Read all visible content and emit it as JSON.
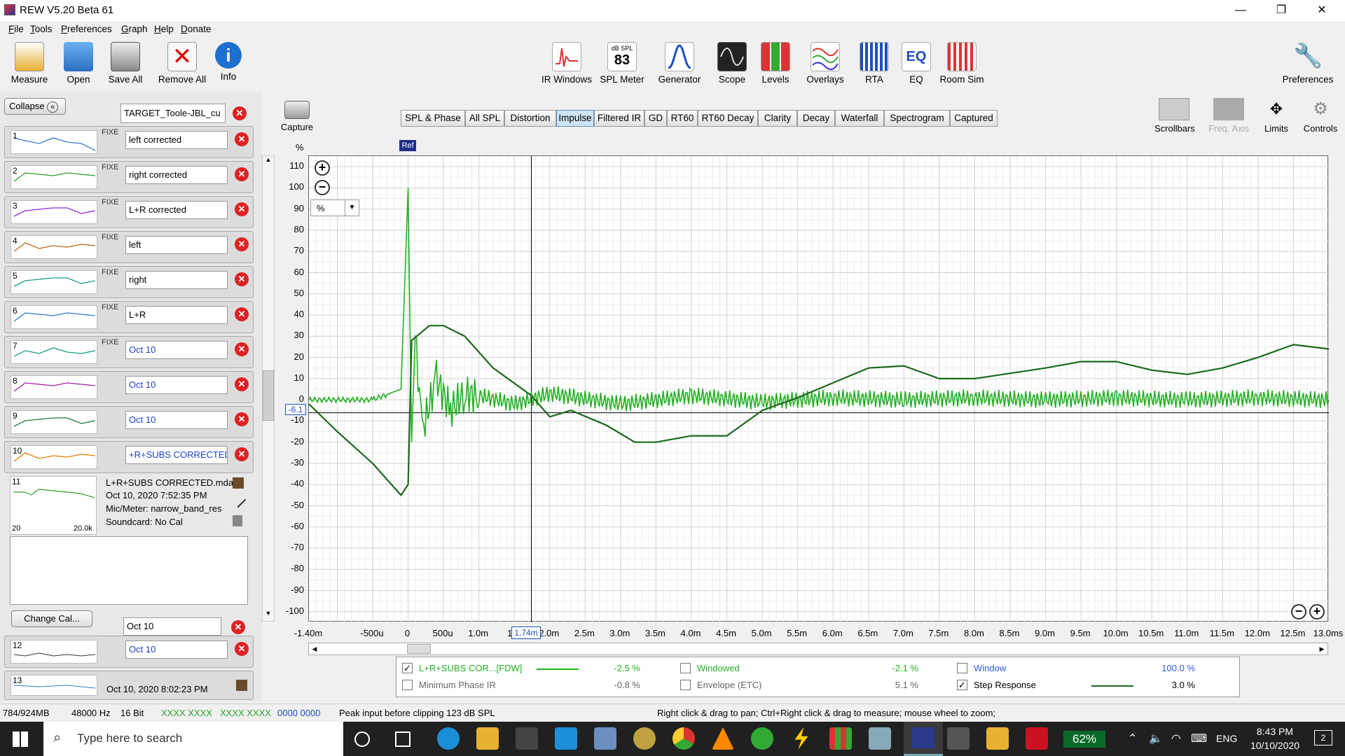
{
  "window": {
    "title": "REW V5.20 Beta 61",
    "minimize": "—",
    "maximize": "❐",
    "close": "✕"
  },
  "menu": [
    "File",
    "Tools",
    "Preferences",
    "Graph",
    "Help",
    "Donate"
  ],
  "toolbar": {
    "left": [
      "Measure",
      "Open",
      "Save All",
      "Remove All",
      "Info"
    ],
    "center": [
      "IR Windows",
      "SPL Meter",
      "Generator",
      "Scope",
      "Levels",
      "Overlays",
      "RTA",
      "EQ",
      "Room Sim"
    ],
    "spl_meter": {
      "unit": "dB SPL",
      "value": "83"
    },
    "eq_icon_text": "EQ",
    "right": "Preferences"
  },
  "capture": {
    "label": "Capture",
    "unit": "%"
  },
  "right_tools": [
    "Scrollbars",
    "Freq. Axis",
    "Limits",
    "Controls"
  ],
  "left_panel": {
    "collapse": "Collapse",
    "target": "TARGET_Toole-JBL_cu",
    "fixed_label": "FIXE",
    "measurements": [
      {
        "num": "1",
        "name": "left corrected",
        "color": "#3a7bd5",
        "fixed": true
      },
      {
        "num": "2",
        "name": "right corrected",
        "color": "#2aa02a",
        "fixed": true
      },
      {
        "num": "3",
        "name": "L+R corrected",
        "color": "#8a2be2",
        "fixed": true
      },
      {
        "num": "4",
        "name": "left",
        "color": "#b8651b",
        "fixed": true
      },
      {
        "num": "5",
        "name": "right",
        "color": "#1a9a8a",
        "fixed": true
      },
      {
        "num": "6",
        "name": "L+R",
        "color": "#2a7bd5",
        "fixed": true
      },
      {
        "num": "7",
        "name": "Oct 10",
        "color": "#1a9a8a",
        "fixed": true
      },
      {
        "num": "8",
        "name": "Oct 10",
        "color": "#a020a0",
        "fixed": false
      },
      {
        "num": "9",
        "name": "Oct 10",
        "color": "#1a7a3a",
        "fixed": false
      },
      {
        "num": "10",
        "name": "+R+SUBS CORRECTED",
        "color": "#e07b00",
        "fixed": false
      }
    ],
    "selected": {
      "num": "11",
      "file": "L+R+SUBS CORRECTED.mda",
      "date": "Oct 10, 2020 7:52:35 PM",
      "mic": "Mic/Meter: narrow_band_res",
      "soundcard": "Soundcard: No Cal",
      "xmin": "20",
      "xmax": "20.0k"
    },
    "change_cal": "Change Cal...",
    "m11_name": "Oct 10",
    "m12": {
      "num": "12",
      "name": "Oct 10"
    },
    "m13": {
      "num": "13",
      "date": "Oct 10, 2020 8:02:23 PM"
    }
  },
  "graph_tabs": [
    "SPL & Phase",
    "All SPL",
    "Distortion",
    "Impulse",
    "Filtered IR",
    "GD",
    "RT60",
    "RT60 Decay",
    "Clarity",
    "Decay",
    "Waterfall",
    "Spectrogram",
    "Captured"
  ],
  "active_tab": "Impulse",
  "graph": {
    "y_unit": "%",
    "unit_select": "%",
    "ref_marker": "Ref",
    "cursor_y": "-6.1",
    "cursor_x": "1.74m"
  },
  "chart_data": {
    "type": "line",
    "title": "",
    "xlabel": "",
    "ylabel": "%",
    "xlim": [
      -1.4,
      13.0
    ],
    "ylim": [
      -105,
      115
    ],
    "y_ticks": [
      "110",
      "100",
      "90",
      "80",
      "70",
      "60",
      "50",
      "40",
      "30",
      "20",
      "10",
      "0",
      "-10",
      "-20",
      "-30",
      "-40",
      "-50",
      "-60",
      "-70",
      "-80",
      "-90",
      "-100"
    ],
    "x_ticks": [
      "-1.40m",
      "-500u",
      "0",
      "500u",
      "1.0m",
      "1.5",
      "2.0m",
      "2.5m",
      "3.0m",
      "3.5m",
      "4.0m",
      "4.5m",
      "5.0m",
      "5.5m",
      "6.0m",
      "6.5m",
      "7.0m",
      "7.5m",
      "8.0m",
      "8.5m",
      "9.0m",
      "9.5m",
      "10.0m",
      "10.5m",
      "11.0m",
      "11.5m",
      "12.0m",
      "12.5m",
      "13.0ms"
    ],
    "series": [
      {
        "name": "L+R+SUBS COR...[FDW]",
        "color": "#22b022",
        "x": [
          -1.4,
          -1.0,
          -0.5,
          -0.1,
          0.0,
          0.05,
          0.1,
          0.2,
          0.4,
          0.6,
          0.8,
          1.0,
          1.5,
          2.0,
          3.0,
          4.0,
          5.0,
          6.0,
          7.0,
          8.0,
          9.0,
          10.0,
          11.0,
          12.0,
          13.0
        ],
        "y": [
          0,
          0,
          0,
          5,
          100,
          -20,
          30,
          -15,
          10,
          -5,
          3,
          2,
          -2,
          3,
          -2,
          2,
          -1,
          1,
          0,
          1,
          0,
          1,
          0,
          1,
          0
        ]
      },
      {
        "name": "Step Response",
        "color": "#1a6a1a",
        "x": [
          -1.4,
          -1.0,
          -0.5,
          -0.1,
          0.0,
          0.05,
          0.3,
          0.5,
          0.8,
          1.2,
          1.74,
          2.0,
          2.3,
          2.8,
          3.2,
          3.5,
          4.0,
          4.5,
          5.0,
          5.5,
          6.0,
          6.5,
          7.0,
          7.5,
          8.0,
          9.0,
          9.5,
          10.0,
          10.5,
          11.0,
          11.5,
          12.0,
          12.5,
          13.0
        ],
        "y": [
          -2,
          -15,
          -30,
          -45,
          -40,
          28,
          35,
          35,
          30,
          15,
          2,
          -8,
          -5,
          -12,
          -20,
          -20,
          -17,
          -17,
          -5,
          1,
          8,
          15,
          16,
          10,
          10,
          15,
          18,
          18,
          14,
          12,
          15,
          20,
          26,
          24
        ]
      }
    ]
  },
  "legend": {
    "row1": [
      {
        "label": "L+R+SUBS COR...[FDW]",
        "value": "-2.5 %",
        "checked": true,
        "color": "#22b022"
      },
      {
        "label": "Windowed",
        "value": "-2.1 %",
        "checked": false,
        "color": "#22b022"
      },
      {
        "label": "Window",
        "value": "100.0 %",
        "checked": false,
        "color": "#2a5bd5"
      }
    ],
    "row2": [
      {
        "label": "Minimum Phase IR",
        "value": "-0.8 %",
        "checked": false,
        "color": "#888888"
      },
      {
        "label": "Envelope (ETC)",
        "value": "5.1 %",
        "checked": false,
        "color": "#000000"
      },
      {
        "label": "Step Response",
        "value": "3.0 %",
        "checked": true,
        "color": "#000000"
      }
    ]
  },
  "status": {
    "memory": "784/924MB",
    "rate": "48000 Hz",
    "bits": "16 Bit",
    "pattern1": "XXXX XXXX",
    "pattern2": "XXXX XXXX",
    "pattern3": "0000 0000",
    "peak": "Peak input before clipping 123 dB SPL",
    "hint": "Right click & drag to pan; Ctrl+Right click & drag to measure; mouse wheel to zoom;"
  },
  "taskbar": {
    "search_placeholder": "Type here to search",
    "battery": "62%",
    "lang": "ENG",
    "time": "8:43 PM",
    "date": "10/10/2020",
    "notif": "2"
  }
}
